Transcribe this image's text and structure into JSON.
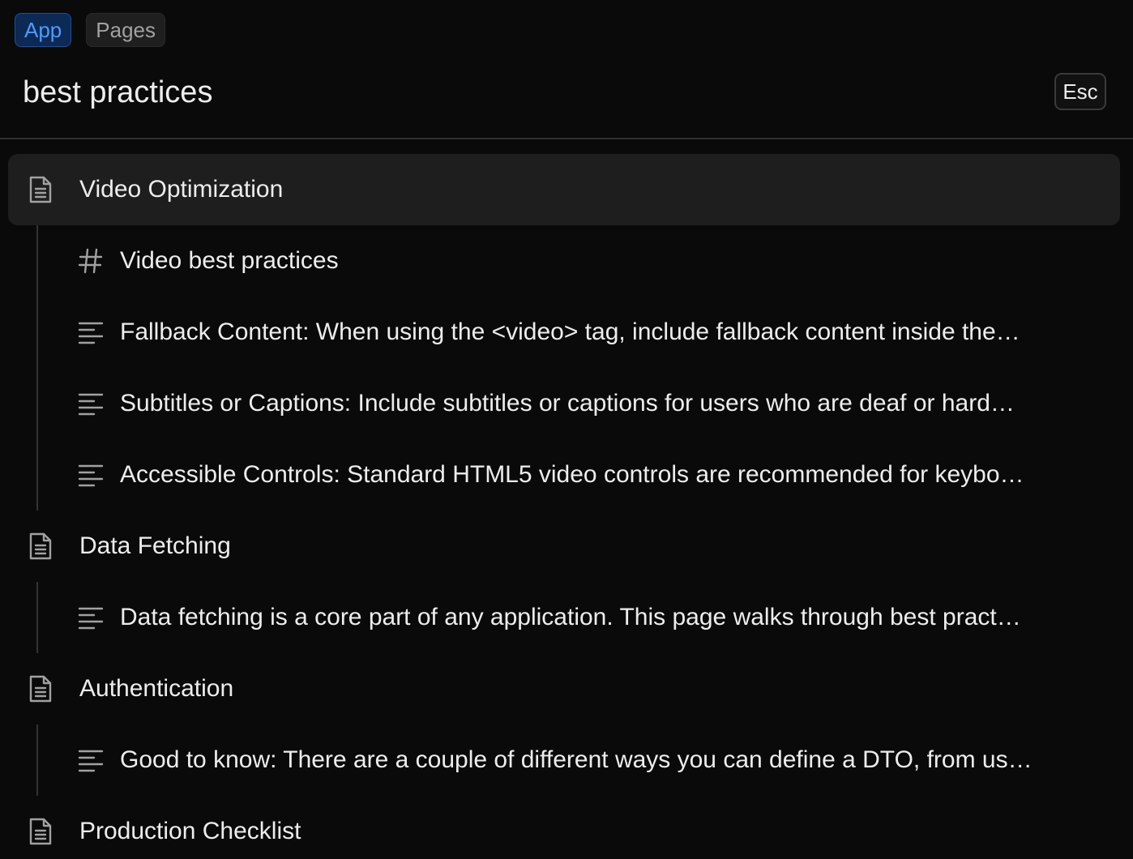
{
  "scopes": [
    {
      "label": "App",
      "active": true
    },
    {
      "label": "Pages",
      "active": false
    }
  ],
  "search": {
    "value": "best practices",
    "esc_label": "Esc"
  },
  "results": [
    {
      "title": "Video Optimization",
      "icon": "page-icon",
      "selected": true,
      "children": [
        {
          "icon": "hash-icon",
          "text": "Video best practices"
        },
        {
          "icon": "text-lines-icon",
          "text": "Fallback Content: When using the <video> tag, include fallback content inside the…"
        },
        {
          "icon": "text-lines-icon",
          "text": "Subtitles or Captions: Include subtitles or captions for users who are deaf or hard…"
        },
        {
          "icon": "text-lines-icon",
          "text": "Accessible Controls: Standard HTML5 video controls are recommended for keybo…"
        }
      ]
    },
    {
      "title": "Data Fetching",
      "icon": "page-icon",
      "selected": false,
      "children": [
        {
          "icon": "text-lines-icon",
          "text": "Data fetching is a core part of any application. This page walks through best pract…"
        }
      ]
    },
    {
      "title": "Authentication",
      "icon": "page-icon",
      "selected": false,
      "children": [
        {
          "icon": "text-lines-icon",
          "text": "Good to know: There are a couple of different ways you can define a DTO, from us…"
        }
      ]
    },
    {
      "title": "Production Checklist",
      "icon": "page-icon",
      "selected": false,
      "children": []
    }
  ],
  "colors": {
    "accent": "#4d9bff",
    "background": "#0a0a0a",
    "selected_row": "#1e1e1e"
  }
}
